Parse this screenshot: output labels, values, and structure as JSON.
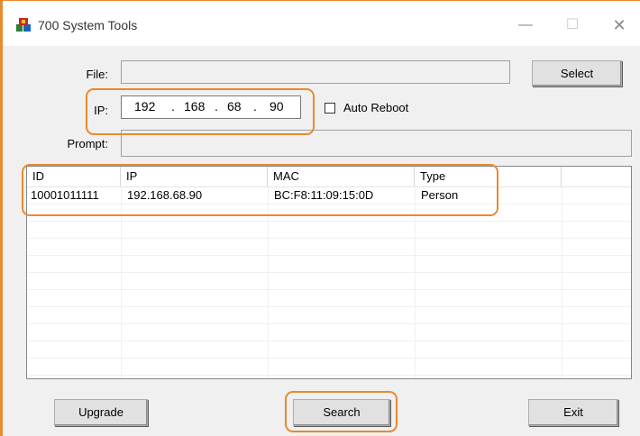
{
  "window": {
    "title": "700 System Tools",
    "minimize_symbol": "—",
    "maximize_symbol": "☐",
    "close_symbol": "✕",
    "icon": "app-icon"
  },
  "form": {
    "file_label": "File:",
    "file_value": "",
    "select_label": "Select",
    "ip_label": "IP:",
    "ip_octets": [
      "192",
      "168",
      "68",
      "90"
    ],
    "ip_separator": ".",
    "auto_reboot_label": "Auto Reboot",
    "auto_reboot_checked": false,
    "prompt_label": "Prompt:",
    "prompt_value": ""
  },
  "table": {
    "columns": [
      "ID",
      "IP",
      "MAC",
      "Type"
    ],
    "rows": [
      [
        "10001011111",
        "192.168.68.90",
        "BC:F8:11:09:15:0D",
        "Person"
      ]
    ]
  },
  "buttons": {
    "upgrade": "Upgrade",
    "search": "Search",
    "exit": "Exit"
  },
  "colors": {
    "highlight": "#e88a2e",
    "window_bg": "#f0f0f0"
  }
}
